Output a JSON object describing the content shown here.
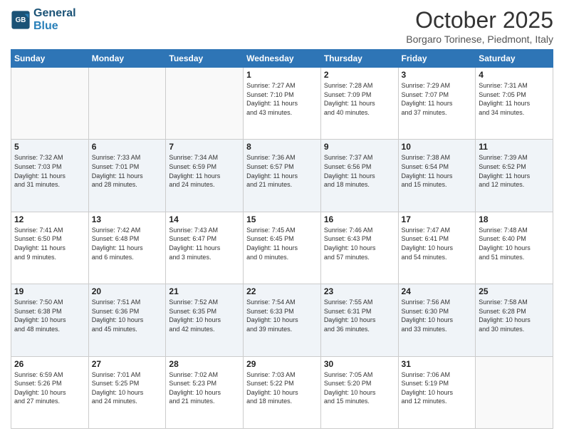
{
  "header": {
    "logo_general": "General",
    "logo_blue": "Blue",
    "month": "October 2025",
    "location": "Borgaro Torinese, Piedmont, Italy"
  },
  "weekdays": [
    "Sunday",
    "Monday",
    "Tuesday",
    "Wednesday",
    "Thursday",
    "Friday",
    "Saturday"
  ],
  "weeks": [
    [
      {
        "day": "",
        "info": ""
      },
      {
        "day": "",
        "info": ""
      },
      {
        "day": "",
        "info": ""
      },
      {
        "day": "1",
        "info": "Sunrise: 7:27 AM\nSunset: 7:10 PM\nDaylight: 11 hours\nand 43 minutes."
      },
      {
        "day": "2",
        "info": "Sunrise: 7:28 AM\nSunset: 7:09 PM\nDaylight: 11 hours\nand 40 minutes."
      },
      {
        "day": "3",
        "info": "Sunrise: 7:29 AM\nSunset: 7:07 PM\nDaylight: 11 hours\nand 37 minutes."
      },
      {
        "day": "4",
        "info": "Sunrise: 7:31 AM\nSunset: 7:05 PM\nDaylight: 11 hours\nand 34 minutes."
      }
    ],
    [
      {
        "day": "5",
        "info": "Sunrise: 7:32 AM\nSunset: 7:03 PM\nDaylight: 11 hours\nand 31 minutes."
      },
      {
        "day": "6",
        "info": "Sunrise: 7:33 AM\nSunset: 7:01 PM\nDaylight: 11 hours\nand 28 minutes."
      },
      {
        "day": "7",
        "info": "Sunrise: 7:34 AM\nSunset: 6:59 PM\nDaylight: 11 hours\nand 24 minutes."
      },
      {
        "day": "8",
        "info": "Sunrise: 7:36 AM\nSunset: 6:57 PM\nDaylight: 11 hours\nand 21 minutes."
      },
      {
        "day": "9",
        "info": "Sunrise: 7:37 AM\nSunset: 6:56 PM\nDaylight: 11 hours\nand 18 minutes."
      },
      {
        "day": "10",
        "info": "Sunrise: 7:38 AM\nSunset: 6:54 PM\nDaylight: 11 hours\nand 15 minutes."
      },
      {
        "day": "11",
        "info": "Sunrise: 7:39 AM\nSunset: 6:52 PM\nDaylight: 11 hours\nand 12 minutes."
      }
    ],
    [
      {
        "day": "12",
        "info": "Sunrise: 7:41 AM\nSunset: 6:50 PM\nDaylight: 11 hours\nand 9 minutes."
      },
      {
        "day": "13",
        "info": "Sunrise: 7:42 AM\nSunset: 6:48 PM\nDaylight: 11 hours\nand 6 minutes."
      },
      {
        "day": "14",
        "info": "Sunrise: 7:43 AM\nSunset: 6:47 PM\nDaylight: 11 hours\nand 3 minutes."
      },
      {
        "day": "15",
        "info": "Sunrise: 7:45 AM\nSunset: 6:45 PM\nDaylight: 11 hours\nand 0 minutes."
      },
      {
        "day": "16",
        "info": "Sunrise: 7:46 AM\nSunset: 6:43 PM\nDaylight: 10 hours\nand 57 minutes."
      },
      {
        "day": "17",
        "info": "Sunrise: 7:47 AM\nSunset: 6:41 PM\nDaylight: 10 hours\nand 54 minutes."
      },
      {
        "day": "18",
        "info": "Sunrise: 7:48 AM\nSunset: 6:40 PM\nDaylight: 10 hours\nand 51 minutes."
      }
    ],
    [
      {
        "day": "19",
        "info": "Sunrise: 7:50 AM\nSunset: 6:38 PM\nDaylight: 10 hours\nand 48 minutes."
      },
      {
        "day": "20",
        "info": "Sunrise: 7:51 AM\nSunset: 6:36 PM\nDaylight: 10 hours\nand 45 minutes."
      },
      {
        "day": "21",
        "info": "Sunrise: 7:52 AM\nSunset: 6:35 PM\nDaylight: 10 hours\nand 42 minutes."
      },
      {
        "day": "22",
        "info": "Sunrise: 7:54 AM\nSunset: 6:33 PM\nDaylight: 10 hours\nand 39 minutes."
      },
      {
        "day": "23",
        "info": "Sunrise: 7:55 AM\nSunset: 6:31 PM\nDaylight: 10 hours\nand 36 minutes."
      },
      {
        "day": "24",
        "info": "Sunrise: 7:56 AM\nSunset: 6:30 PM\nDaylight: 10 hours\nand 33 minutes."
      },
      {
        "day": "25",
        "info": "Sunrise: 7:58 AM\nSunset: 6:28 PM\nDaylight: 10 hours\nand 30 minutes."
      }
    ],
    [
      {
        "day": "26",
        "info": "Sunrise: 6:59 AM\nSunset: 5:26 PM\nDaylight: 10 hours\nand 27 minutes."
      },
      {
        "day": "27",
        "info": "Sunrise: 7:01 AM\nSunset: 5:25 PM\nDaylight: 10 hours\nand 24 minutes."
      },
      {
        "day": "28",
        "info": "Sunrise: 7:02 AM\nSunset: 5:23 PM\nDaylight: 10 hours\nand 21 minutes."
      },
      {
        "day": "29",
        "info": "Sunrise: 7:03 AM\nSunset: 5:22 PM\nDaylight: 10 hours\nand 18 minutes."
      },
      {
        "day": "30",
        "info": "Sunrise: 7:05 AM\nSunset: 5:20 PM\nDaylight: 10 hours\nand 15 minutes."
      },
      {
        "day": "31",
        "info": "Sunrise: 7:06 AM\nSunset: 5:19 PM\nDaylight: 10 hours\nand 12 minutes."
      },
      {
        "day": "",
        "info": ""
      }
    ]
  ]
}
